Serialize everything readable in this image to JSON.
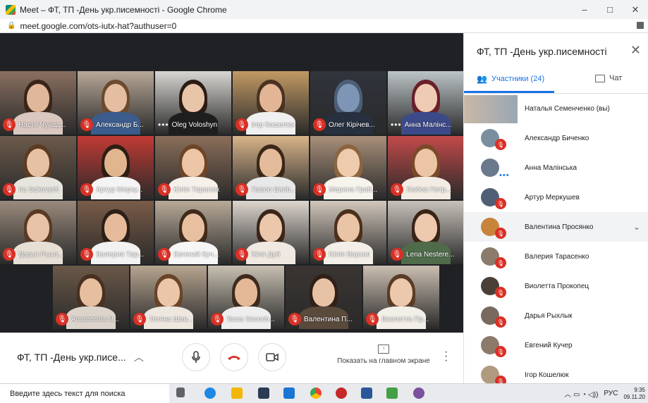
{
  "window": {
    "title": "Meet – ФТ, ТП -День укр.писемності - Google Chrome",
    "minimize": "–",
    "maximize": "□",
    "close": "✕"
  },
  "address": {
    "url": "meet.google.com/ots-iutx-hat?authuser=0"
  },
  "grid": {
    "tiles": [
      {
        "name": "Настя Чунад...",
        "status": "muted",
        "skin": "#e0b79a",
        "hair": "#3b2518",
        "shirt": "#d9c7c0",
        "bg": "#8a6f60"
      },
      {
        "name": "Александр Б...",
        "status": "muted",
        "skin": "#e5bea1",
        "hair": "#6b4a2f",
        "shirt": "#3b5c8c",
        "bg": "#b8a898"
      },
      {
        "name": "Oleg Voloshyn",
        "status": "active",
        "skin": "#e8c4a8",
        "hair": "#2a1c14",
        "shirt": "#1e1e1e",
        "bg": "#d8d6d2"
      },
      {
        "name": "Ігор Кошелюк",
        "status": "muted",
        "skin": "#e2b594",
        "hair": "#4a3222",
        "shirt": "#f0f0f0",
        "bg": "#c29a64"
      },
      {
        "name": "Олег Кірічев...",
        "status": "muted",
        "skin": "#7e95b5",
        "hair": "#4d5f78",
        "shirt": "#26303e",
        "bg": "#30343c"
      },
      {
        "name": "Анна Малінс...",
        "status": "active",
        "skin": "#efcbb3",
        "hair": "#6a1f2a",
        "shirt": "#3d4a8a",
        "bg": "#bcc4c6"
      },
      {
        "name": "Ira Sakovych",
        "status": "muted",
        "skin": "#e7c1a4",
        "hair": "#5b3b22",
        "shirt": "#e8e4de",
        "bg": "#6c5a4c"
      },
      {
        "name": "Артур Мерку...",
        "status": "muted",
        "skin": "#e1b58e",
        "hair": "#2d1e14",
        "shirt": "#f4f4f4",
        "bg": "#c23a34"
      },
      {
        "name": "Юлія Тарасюк",
        "status": "muted",
        "skin": "#edc6a8",
        "hair": "#6e4526",
        "shirt": "#f5f0ea",
        "bg": "#8b6e5a"
      },
      {
        "name": "Павло Вигів...",
        "status": "muted",
        "skin": "#e4bb9a",
        "hair": "#3a2718",
        "shirt": "#e8e8e8",
        "bg": "#d8b58a"
      },
      {
        "name": "Марина Граб...",
        "status": "muted",
        "skin": "#efcbae",
        "hair": "#8b6440",
        "shirt": "#f7f4ee",
        "bg": "#a88f7a"
      },
      {
        "name": "Любов Петр...",
        "status": "muted",
        "skin": "#ecc5a6",
        "hair": "#7a4a28",
        "shirt": "#f2ece4",
        "bg": "#c24a4a"
      },
      {
        "name": "Дарья Рыхл...",
        "status": "muted",
        "skin": "#e9c3a7",
        "hair": "#5a3a24",
        "shirt": "#e6dfd6",
        "bg": "#9a8a7c"
      },
      {
        "name": "Валерия Тар...",
        "status": "muted",
        "skin": "#e6bb9b",
        "hair": "#2e1f16",
        "shirt": "#f2f2f2",
        "bg": "#7a5c48"
      },
      {
        "name": "Евгений Куч...",
        "status": "muted",
        "skin": "#e8c0a0",
        "hair": "#3f2a1b",
        "shirt": "#f6f6f6",
        "bg": "#b8aa98"
      },
      {
        "name": "Юля Дуб",
        "status": "muted",
        "skin": "#ebc7ac",
        "hair": "#3b2518",
        "shirt": "#efe9e2",
        "bg": "#ddd6ce"
      },
      {
        "name": "Юлія Варкол",
        "status": "muted",
        "skin": "#eac4a6",
        "hair": "#4b2f1c",
        "shirt": "#f3efe8",
        "bg": "#d2c8bc"
      },
      {
        "name": "Lena Nestere...",
        "status": "muted",
        "skin": "#edc9ae",
        "hair": "#3a2416",
        "shirt": "#4f6b4a",
        "bg": "#c8c2bb"
      },
      {
        "name": "Anasteisha N...",
        "status": "muted",
        "skin": "#e6bf9f",
        "hair": "#4a3020",
        "shirt": "#dcd4cb",
        "bg": "#6a5848"
      },
      {
        "name": "Тетяна Шев...",
        "status": "muted",
        "skin": "#ecc6a9",
        "hair": "#6a4428",
        "shirt": "#ede7df",
        "bg": "#b7a590"
      },
      {
        "name": "Taras Savoch...",
        "status": "muted",
        "skin": "#e3b998",
        "hair": "#3d2a1c",
        "shirt": "#eeeeee",
        "bg": "#c8c0b2"
      },
      {
        "name": "Валентина П...",
        "status": "muted",
        "skin": "#e7c2a5",
        "hair": "#2f2018",
        "shirt": "#5a4a3c",
        "bg": "#3a3532"
      },
      {
        "name": "Виолетта Пр...",
        "status": "muted",
        "skin": "#ecc8ad",
        "hair": "#5a3c26",
        "shirt": "#f2eee8",
        "bg": "#cbbfb2"
      }
    ]
  },
  "controls": {
    "meeting_title": "ФТ, ТП -День укр.писе...",
    "present_label": "Показать на главном экране"
  },
  "panel": {
    "title": "ФТ, ТП -День укр.писемності",
    "people_tab": "Участники (24)",
    "chat_tab": "Чат",
    "participants": [
      {
        "name": "Наталья Семенченко (вы)",
        "avatar": "#9aa7b3",
        "muted": false
      },
      {
        "name": "Александр Биченко",
        "avatar": "#7b8ea0",
        "muted": true
      },
      {
        "name": "Анна Малінська",
        "avatar": "#6a7a8c",
        "muted": false,
        "speaking": true
      },
      {
        "name": "Артур Меркушев",
        "avatar": "#4f5f75",
        "muted": true
      },
      {
        "name": "Валентина Просянко",
        "avatar": "#c8843a",
        "muted": true,
        "highlight": true
      },
      {
        "name": "Валерия Тарасенко",
        "avatar": "#8a7b6a",
        "muted": true
      },
      {
        "name": "Виолетта Прокопец",
        "avatar": "#4b4038",
        "muted": true
      },
      {
        "name": "Дарья Рыхлык",
        "avatar": "#7a6a5d",
        "muted": true
      },
      {
        "name": "Евгений Кучер",
        "avatar": "#8c7a6b",
        "muted": true
      },
      {
        "name": "Ігор Кошелюк",
        "avatar": "#b09a80",
        "muted": true
      }
    ]
  },
  "taskbar": {
    "search_placeholder": "Введите здесь текст для поиска",
    "language": "РУС",
    "time": "9:35",
    "date": "09.11.20"
  }
}
